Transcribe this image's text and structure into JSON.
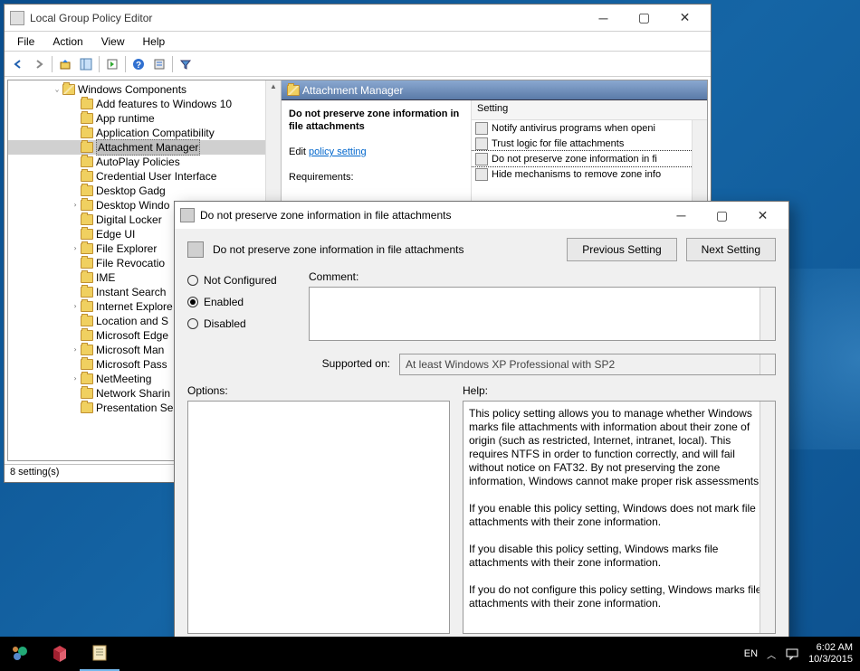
{
  "gpe": {
    "title": "Local Group Policy Editor",
    "menu": {
      "file": "File",
      "action": "Action",
      "view": "View",
      "help": "Help"
    },
    "tree": {
      "root": "Windows Components",
      "items": [
        "Add features to Windows 10",
        "App runtime",
        "Application Compatibility",
        "Attachment Manager",
        "AutoPlay Policies",
        "Credential User Interface",
        "Desktop Gadg",
        "Desktop Windo",
        "Digital Locker",
        "Edge UI",
        "File Explorer",
        "File Revocatio",
        "IME",
        "Instant Search",
        "Internet Explore",
        "Location and S",
        "Microsoft Edge",
        "Microsoft Man",
        "Microsoft Pass",
        "NetMeeting",
        "Network Sharin",
        "Presentation Se"
      ],
      "expandable": [
        7,
        10,
        14,
        17,
        19
      ],
      "selected_index": 3
    },
    "list": {
      "header": "Attachment Manager",
      "policy_name": "Do not preserve zone information in file attachments",
      "edit_label": "Edit",
      "edit_link": "policy setting",
      "requirements_label": "Requirements:",
      "setting_col": "Setting",
      "settings": [
        "Notify antivirus programs when openi",
        "Trust logic for file attachments",
        "Do not preserve zone information in fi",
        "Hide mechanisms to remove zone info"
      ],
      "highlighted_index": 2
    },
    "status": "8 setting(s)"
  },
  "props": {
    "title": "Do not preserve zone information in file attachments",
    "subtitle": "Do not preserve zone information in file attachments",
    "prev_btn": "Previous Setting",
    "next_btn": "Next Setting",
    "radios": {
      "not_configured": "Not Configured",
      "enabled": "Enabled",
      "disabled": "Disabled"
    },
    "selected_radio": "enabled",
    "comment_label": "Comment:",
    "supported_label": "Supported on:",
    "supported_text": "At least Windows XP Professional with SP2",
    "options_label": "Options:",
    "help_label": "Help:",
    "help_p1": "This policy setting allows you to manage whether Windows marks file attachments with information about their zone of origin (such as restricted, Internet, intranet, local). This requires NTFS in order to function correctly, and will fail without notice on FAT32. By not preserving the zone information, Windows cannot make proper risk assessments.",
    "help_p2": "If you enable this policy setting, Windows does not mark file attachments with their zone information.",
    "help_p3": "If you disable this policy setting, Windows marks file attachments with their zone information.",
    "help_p4": "If you do not configure this policy setting, Windows marks file attachments with their zone information."
  },
  "taskbar": {
    "lang": "EN",
    "time": "6:02 AM",
    "date": "10/3/2015"
  }
}
